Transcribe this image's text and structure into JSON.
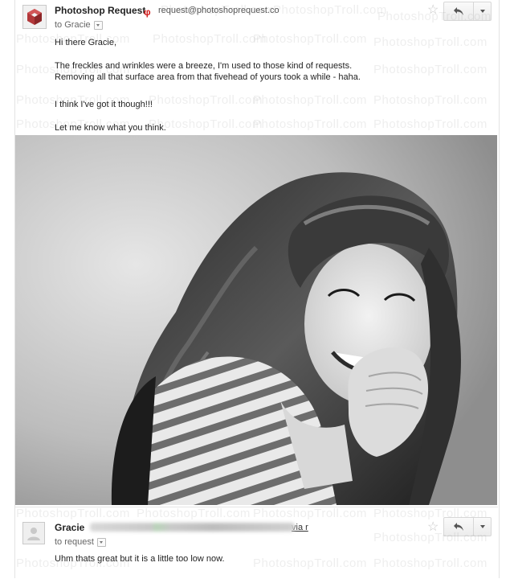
{
  "message1": {
    "sender": "Photoshop Request",
    "importance_marker": "φ",
    "email": "request@photoshoprequest.co",
    "to_label": "to Gracie",
    "lines": [
      "Hi there Gracie,",
      "The freckles and wrinkles were a breeze, I'm used to those kind of requests.",
      "Removing all that surface area from that fivehead of yours took a while - haha.",
      "I think I've got it though!!!",
      "Let me know what you think."
    ],
    "icons": [
      "cube-avatar-icon",
      "star-icon",
      "reply-icon",
      "chevron-down-icon"
    ]
  },
  "photo": {
    "description_icon": "photo-woman-laughing-striped-shirt"
  },
  "message2": {
    "sender": "Gracie",
    "via_label": "via r",
    "to_label": "to request",
    "lines": [
      "Uhm thats great but it is a little too low now."
    ],
    "icons": [
      "person-avatar-icon",
      "star-icon",
      "reply-icon",
      "chevron-down-icon"
    ]
  },
  "watermark": {
    "text": "PhotoshopTroll.com"
  },
  "colors": {
    "importance": "#d31818",
    "text": "#222222",
    "muted": "#666666",
    "border": "#d7d7d7"
  }
}
